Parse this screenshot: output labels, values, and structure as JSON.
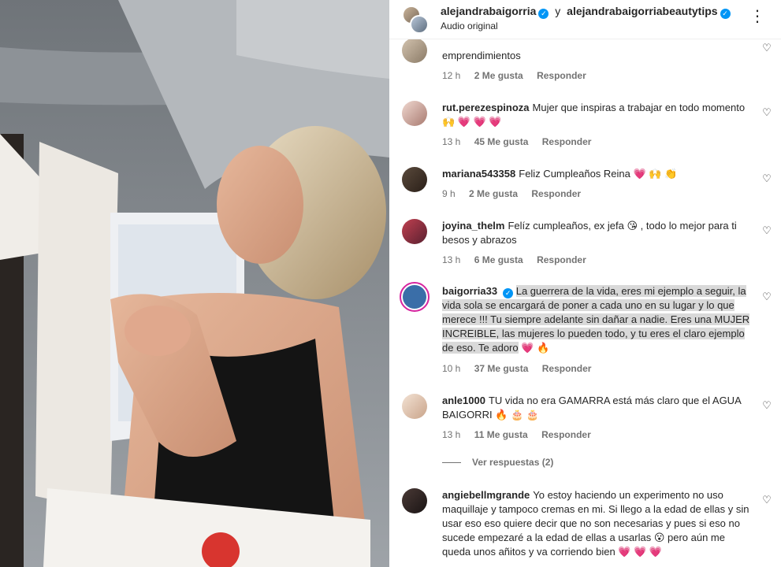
{
  "header": {
    "user1": "alejandrabaigorria",
    "connector": "y",
    "user2": "alejandrabaigorriabeautytips",
    "audio": "Audio original"
  },
  "icons": {
    "verified": "verified-badge-icon",
    "more": "more-options-icon",
    "like": "heart-outline-icon"
  },
  "comments": [
    {
      "user": "",
      "text": "emprendimientos",
      "time": "12 h",
      "likes": "2 Me gusta",
      "reply": "Responder"
    },
    {
      "user": "rut.perezespinoza",
      "text": "Mujer que inspiras a trabajar en todo momento 🙌 💗 💗 💗",
      "time": "13 h",
      "likes": "45 Me gusta",
      "reply": "Responder"
    },
    {
      "user": "mariana543358",
      "text": "Feliz Cumpleaños Reina 💗 🙌 👏",
      "time": "9 h",
      "likes": "2 Me gusta",
      "reply": "Responder"
    },
    {
      "user": "joyina_thelm",
      "text": "Felíz cumpleaños, ex jefa 😘 , todo lo mejor para ti besos y abrazos",
      "time": "13 h",
      "likes": "6 Me gusta",
      "reply": "Responder"
    },
    {
      "user": "baigorria33",
      "text": "La guerrera de la vida, eres mi ejemplo a seguir, la vida sola se encargará de poner a cada uno en su lugar y lo que merece !!! Tu siempre adelante sin dañar a nadie. Eres una MUJER INCREIBLE, las mujeres lo pueden todo, y tu eres el claro ejemplo de eso. Te adoro",
      "text_tail": "💗 🔥",
      "time": "10 h",
      "likes": "37 Me gusta",
      "reply": "Responder"
    },
    {
      "user": "anle1000",
      "text": "TU vida no era GAMARRA está más claro que el AGUA BAIGORRI 🔥 🎂 🎂",
      "time": "13 h",
      "likes": "11 Me gusta",
      "reply": "Responder"
    },
    {
      "user": "angiebellmgrande",
      "text": "Yo estoy haciendo un experimento no uso maquillaje y tampoco cremas en mi. Si llego a la edad de ellas y sin usar eso eso quiere decir que no son necesarias y pues si eso no sucede empezaré a la edad de ellas a usarlas 😮 pero aún me queda unos añitos y va corriendo bien 💗 💗 💗"
    }
  ],
  "view_replies": "Ver respuestas (2)",
  "colors": {
    "text": "#262626",
    "meta": "#737373",
    "verified": "#0095f6",
    "highlight": "#d9d9d9",
    "heart_emoji": "#e8265e"
  }
}
